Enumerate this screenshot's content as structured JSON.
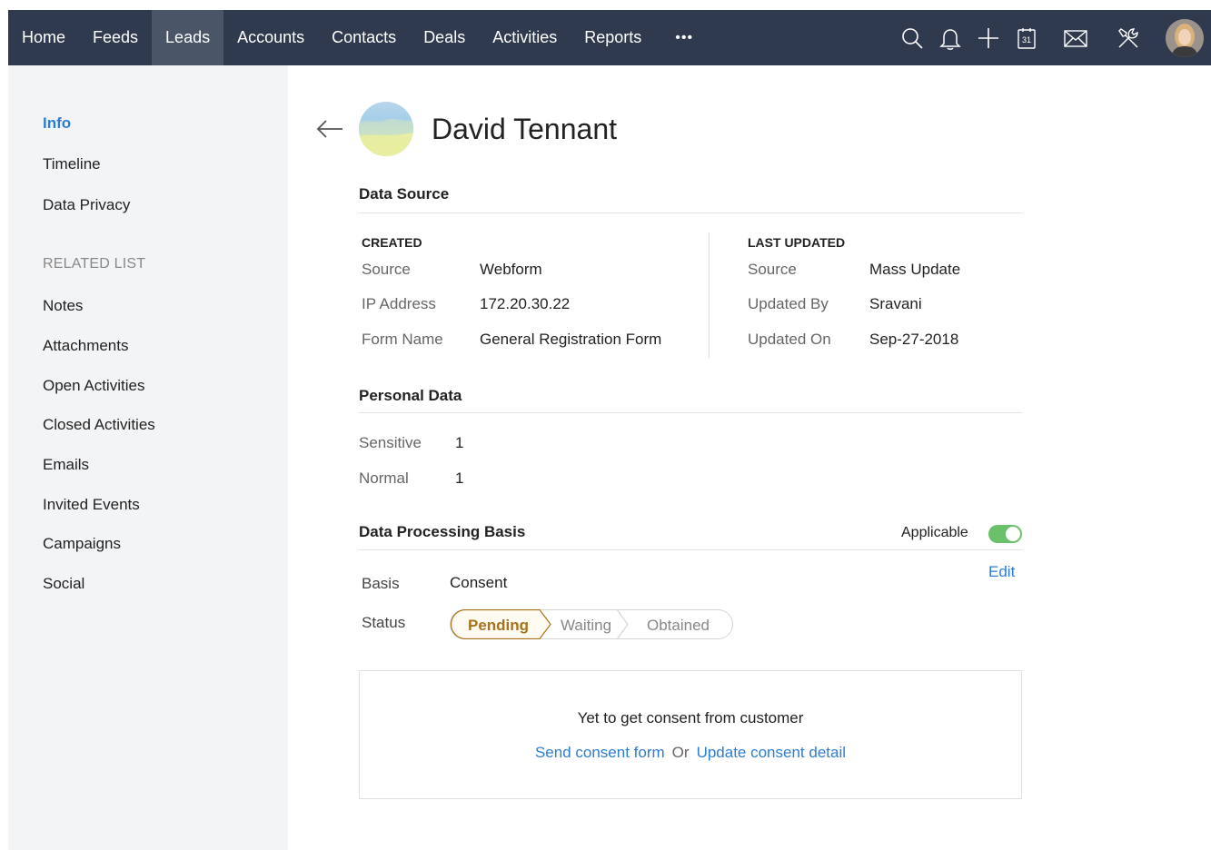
{
  "nav": {
    "tabs": [
      {
        "label": "Home"
      },
      {
        "label": "Feeds"
      },
      {
        "label": "Leads"
      },
      {
        "label": "Accounts"
      },
      {
        "label": "Contacts"
      },
      {
        "label": "Deals"
      },
      {
        "label": "Activities"
      },
      {
        "label": "Reports"
      }
    ],
    "active_tab": "Leads",
    "more_label": "•••",
    "calendar_day": "31",
    "icons": [
      "search-icon",
      "bell-icon",
      "plus-icon",
      "calendar-icon",
      "mail-icon",
      "tools-icon"
    ]
  },
  "sidebar": {
    "items": [
      {
        "label": "Info"
      },
      {
        "label": "Timeline"
      },
      {
        "label": "Data Privacy"
      }
    ],
    "related_heading": "RELATED LIST",
    "related": [
      {
        "label": "Notes"
      },
      {
        "label": "Attachments"
      },
      {
        "label": "Open Activities"
      },
      {
        "label": "Closed Activities"
      },
      {
        "label": "Emails"
      },
      {
        "label": "Invited Events"
      },
      {
        "label": "Campaigns"
      },
      {
        "label": "Social"
      }
    ],
    "active_item": "Info"
  },
  "lead": {
    "name": "David Tennant"
  },
  "data_source": {
    "title": "Data Source",
    "created": {
      "heading": "CREATED",
      "rows": [
        {
          "label": "Source",
          "value": "Webform"
        },
        {
          "label": "IP Address",
          "value": "172.20.30.22"
        },
        {
          "label": "Form Name",
          "value": "General Registration Form"
        }
      ]
    },
    "last_updated": {
      "heading": "LAST UPDATED",
      "rows": [
        {
          "label": "Source",
          "value": "Mass Update"
        },
        {
          "label": "Updated By",
          "value": "Sravani"
        },
        {
          "label": "Updated On",
          "value": "Sep-27-2018"
        }
      ]
    }
  },
  "personal_data": {
    "title": "Personal Data",
    "rows": [
      {
        "label": "Sensitive",
        "value": "1"
      },
      {
        "label": "Normal",
        "value": "1"
      }
    ]
  },
  "processing": {
    "title": "Data Processing Basis",
    "applicable_label": "Applicable",
    "applicable_on": true,
    "edit_label": "Edit",
    "basis_label": "Basis",
    "basis_value": "Consent",
    "status_label": "Status",
    "status_steps": [
      "Pending",
      "Waiting",
      "Obtained"
    ],
    "current_status": "Pending"
  },
  "consent": {
    "message": "Yet to get consent from customer",
    "send_link": "Send consent form",
    "or_text": "Or",
    "update_link": "Update consent detail"
  },
  "colors": {
    "nav_bg": "#303a4e",
    "nav_active": "#4a5568",
    "accent_blue": "#2d7dd2",
    "pending_brown": "#a8721b",
    "toggle_green": "#6cc06c"
  }
}
